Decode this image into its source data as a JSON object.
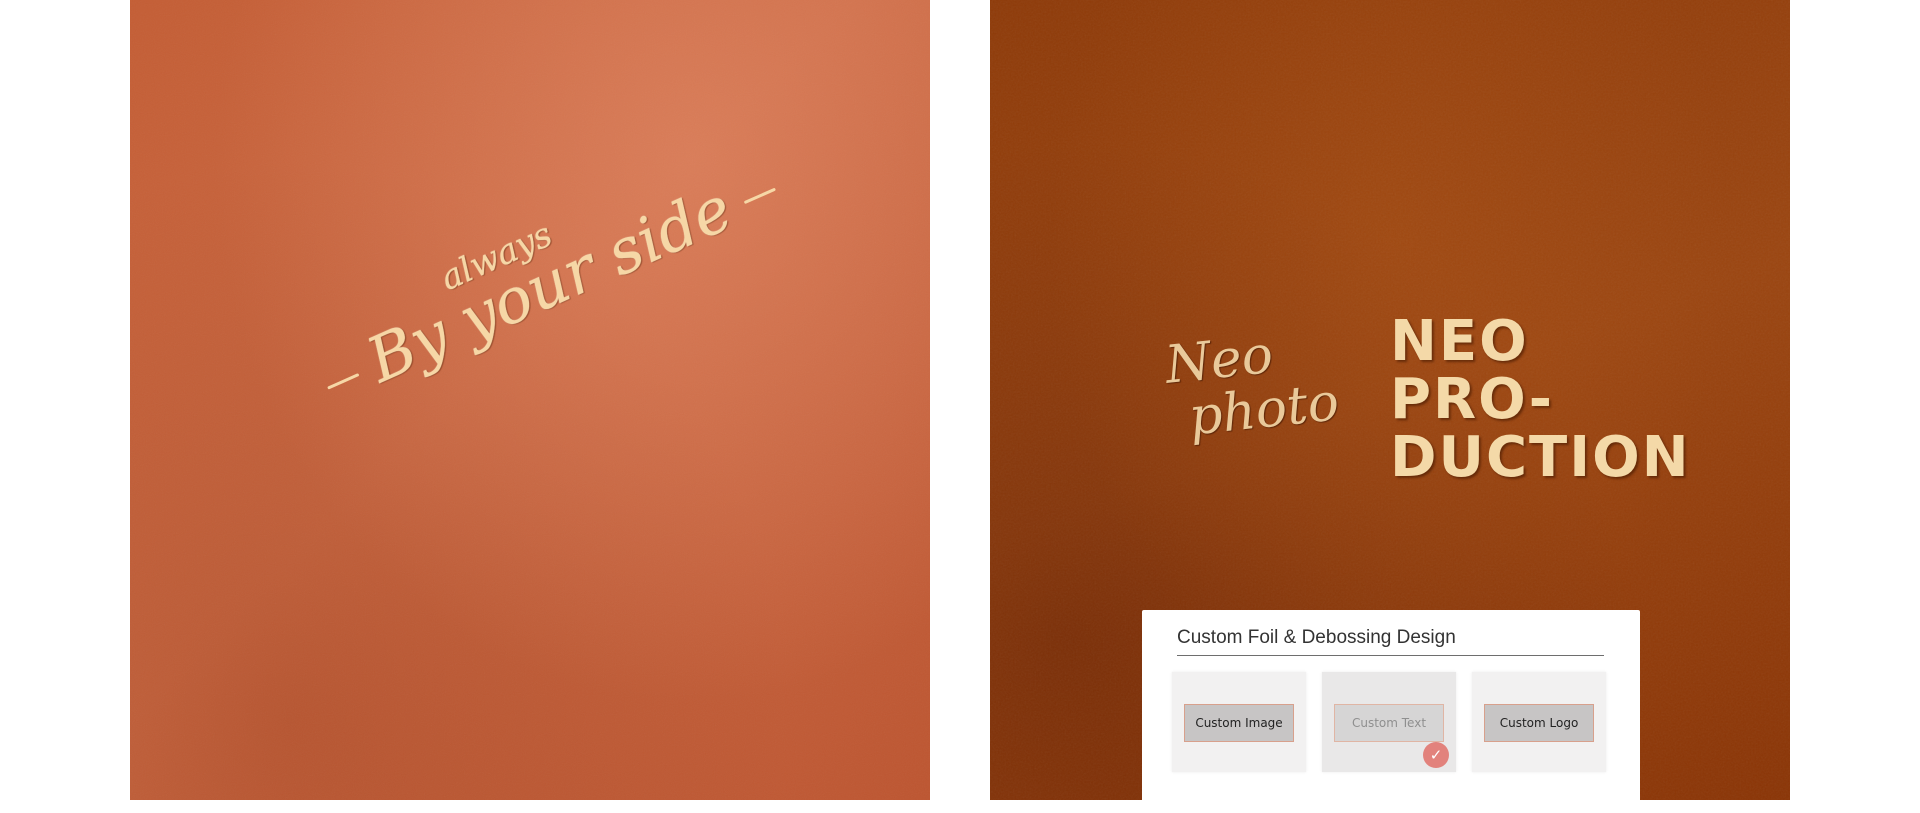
{
  "left_photo": {
    "engraving": {
      "small_word": "always",
      "main_line": "By your side"
    }
  },
  "right_photo": {
    "script_lines": [
      "Neo",
      "photo"
    ],
    "block_lines": [
      "NEO",
      "PRO-",
      "DUCTION"
    ]
  },
  "design_card": {
    "title": "Custom Foil & Debossing Design",
    "options": [
      {
        "label": "Custom Image",
        "selected": false
      },
      {
        "label": "Custom Text",
        "selected": true
      },
      {
        "label": "Custom Logo",
        "selected": false
      }
    ],
    "selected_icon": "checkmark-icon"
  },
  "colors": {
    "left_leather": "#c45d34",
    "right_leather": "#8e3a08",
    "foil_gold": "#f6d7a6",
    "check_badge": "#e2827c"
  }
}
